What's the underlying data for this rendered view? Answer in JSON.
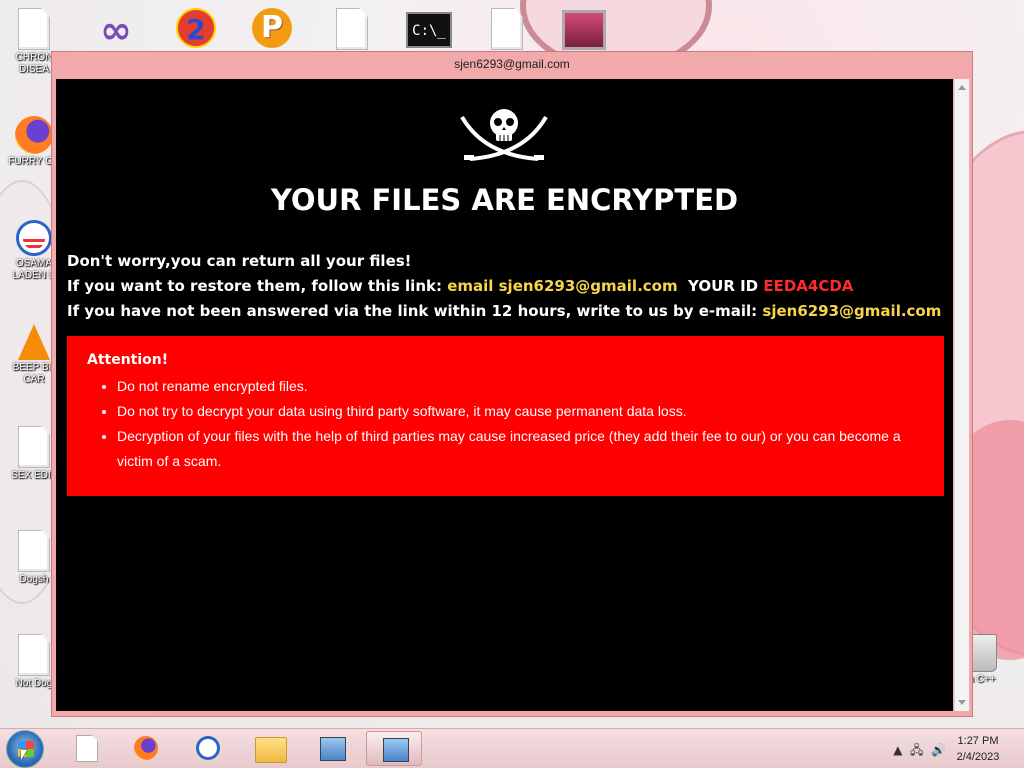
{
  "desktop": {
    "icons": [
      {
        "label": "CHRON\nDISEA",
        "icon": "document-icon"
      },
      {
        "label": "",
        "icon": "visual-studio-icon"
      },
      {
        "label": "",
        "icon": "portal2-icon"
      },
      {
        "label": "",
        "icon": "p-app-icon"
      },
      {
        "label": "",
        "icon": "document-icon"
      },
      {
        "label": "",
        "icon": "cmd-icon"
      },
      {
        "label": "",
        "icon": "document-icon"
      },
      {
        "label": "",
        "icon": "video-icon"
      },
      {
        "label": "FURRY CU",
        "icon": "firefox-icon"
      },
      {
        "label": "OSAMA\nLADEN B",
        "icon": "obama-icon"
      },
      {
        "label": "BEEP BE\nCAR",
        "icon": "vlc-icon"
      },
      {
        "label": "SEX EDIT",
        "icon": "document-icon"
      },
      {
        "label": "Dogsh",
        "icon": "document-icon"
      },
      {
        "label": "Not Dog",
        "icon": "document-icon"
      },
      {
        "label": "n C++",
        "icon": "recycle-bin-icon"
      }
    ]
  },
  "window": {
    "title": "sjen6293@gmail.com",
    "headline": "YOUR FILES ARE ENCRYPTED",
    "line1": "Don't worry,you can return all your files!",
    "line2_prefix": "If you want to restore them, follow this link: ",
    "line2_email": "email sjen6293@gmail.com",
    "line2_id_label": "  YOUR ID ",
    "line2_id": "EEDA4CDA",
    "line3_prefix": "If you have not been answered via the link within 12 hours, write to us by e-mail: ",
    "line3_email": "sjen6293@gmail.com",
    "attention": {
      "title": "Attention!",
      "items": [
        "Do not rename encrypted files.",
        "Do not try to decrypt your data using third party software, it may cause permanent data loss.",
        "Decryption of your files with the help of third parties may cause increased price (they add their fee to our) or you can become a victim of a scam."
      ]
    }
  },
  "taskbar": {
    "clock_time": "1:27 PM",
    "clock_date": "2/4/2023"
  },
  "colors": {
    "window_frame": "#f1a9ab",
    "attention_bg": "#ff0000",
    "email_color": "#f7d44a",
    "id_color": "#ff2b2b"
  }
}
